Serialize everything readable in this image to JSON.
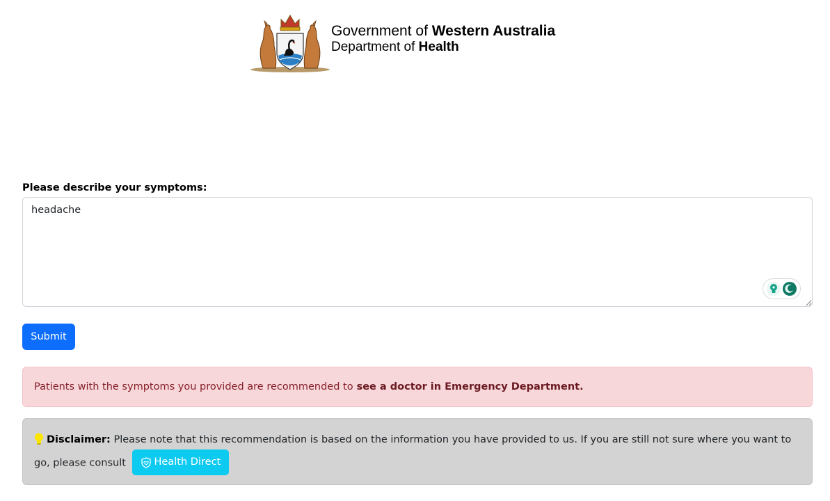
{
  "header": {
    "gov_prefix": "Government of ",
    "gov_bold": "Western Australia",
    "dept_prefix": "Department of ",
    "dept_bold": "Health",
    "crest_icon": "wa-coat-of-arms-icon"
  },
  "form": {
    "label": "Please describe your symptoms:",
    "symptoms_value": "headache",
    "submit_label": "Submit"
  },
  "result": {
    "text": "Patients with the symptoms you provided are recommended to",
    "recommendation": "see a doctor in Emergency Department.",
    "colors": {
      "background": "#f8d7da",
      "text": "#842029"
    }
  },
  "disclaimer": {
    "label": "Disclaimer:",
    "text": " Please note that this recommendation is based on the information you have provided to us. If you are still not sure where you want to go, please consult",
    "button_label": "Health Direct",
    "icons": [
      "lightbulb-icon",
      "shield-heart-icon"
    ]
  },
  "colors": {
    "primary": "#0d6efd",
    "info": "#0dcaf0"
  }
}
